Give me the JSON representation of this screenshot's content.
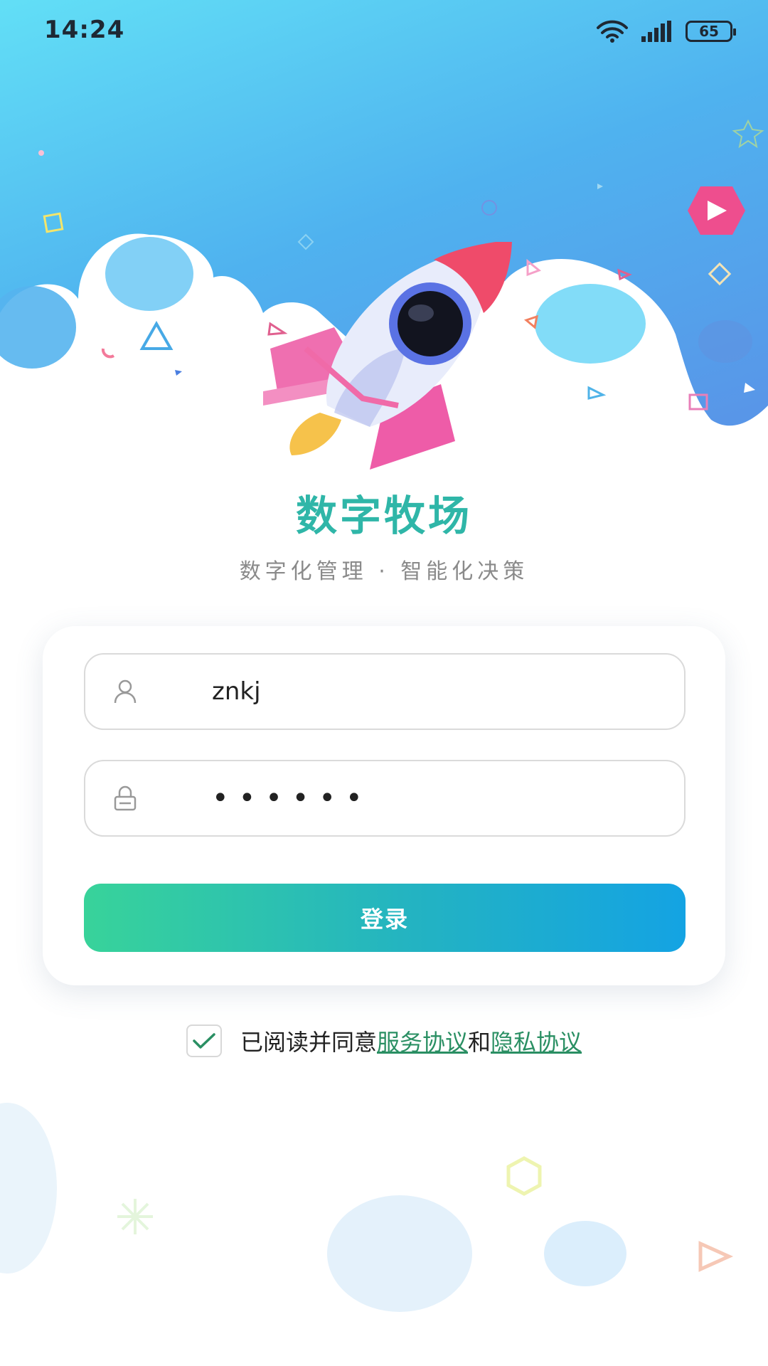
{
  "status_bar": {
    "time": "14:24",
    "battery_level": "65",
    "icons": [
      "wifi-icon",
      "signal-icon",
      "battery-icon"
    ]
  },
  "app": {
    "title": "数字牧场",
    "subtitle": "数字化管理 · 智能化决策"
  },
  "form": {
    "username_value": "znkj",
    "password_value": "••••••",
    "login_label": "登录"
  },
  "agreement": {
    "checked": true,
    "prefix": "已阅读并同意",
    "service_link": "服务协议",
    "conjunction": "和",
    "privacy_link": "隐私协议"
  },
  "colors": {
    "title": "#2fb6a8",
    "link": "#2a8f63",
    "button_gradient_start": "#38d39a",
    "button_gradient_end": "#14a3e3",
    "header_gradient_start": "#62dff6",
    "header_gradient_end": "#5b8de6"
  }
}
